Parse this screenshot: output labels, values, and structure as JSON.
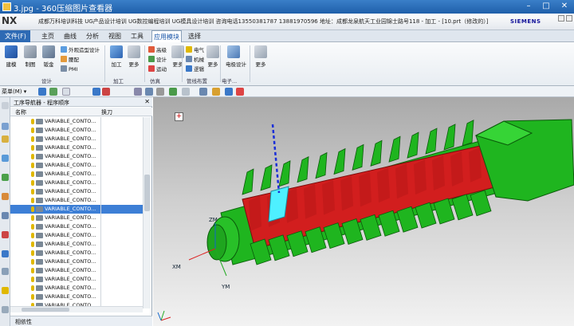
{
  "viewer": {
    "title": "3.jpg - 360压缩图片查看器",
    "min_label": "–",
    "max_label": "□",
    "close_label": "✕"
  },
  "nx": {
    "logo": "NX",
    "title_text": "成都万科培训科技    UG产品设计培训    UG数控编程培训    UG模具设计培训    咨询电话13550381787  13881970596   地址：成都龙泉航天工业园锦士路号118 - 加工 - [10.prt（修改的）]",
    "brand": "SIEMENS"
  },
  "menu": {
    "file": "文件(F)",
    "tabs": [
      "主页",
      "曲线",
      "分析",
      "视图",
      "工具",
      "应用模块",
      "选择"
    ],
    "active": "应用模块"
  },
  "ribbon": {
    "big": [
      "建模",
      "制图",
      "钣金"
    ],
    "small_col1": [
      "外观造型设计",
      "腰配",
      "PMI"
    ],
    "machining": "加工",
    "more": "更多",
    "sim": [
      "高级",
      "设计",
      "运动"
    ],
    "pipe": [
      "电气",
      "机械",
      "逻辑"
    ],
    "electrode": "电极设计",
    "groups": [
      "设计",
      "加工",
      "仿真",
      "管线布置",
      "电子..."
    ]
  },
  "toolbar2": {
    "menu_label": "菜单(M) ▾"
  },
  "navigator": {
    "title": "工序导航器 - 程序顺序",
    "col_name": "名称",
    "col_tool": "换刀",
    "rows": [
      "VARIABLE_CONTO...",
      "VARIABLE_CONTO...",
      "VARIABLE_CONTO...",
      "VARIABLE_CONTO...",
      "VARIABLE_CONTO...",
      "VARIABLE_CONTO...",
      "VARIABLE_CONTO...",
      "VARIABLE_CONTO...",
      "VARIABLE_CONTO...",
      "VARIABLE_CONTO...",
      "VARIABLE_CONTO...",
      "VARIABLE_CONTO...",
      "VARIABLE_CONTO...",
      "VARIABLE_CONTO...",
      "VARIABLE_CONTO...",
      "VARIABLE_CONTO...",
      "VARIABLE_CONTO...",
      "VARIABLE_CONTO...",
      "VARIABLE_CONTO...",
      "VARIABLE_CONTO...",
      "VARIABLE_CONTO...",
      "VARIABLE_CONTO..."
    ],
    "selected_index": 10,
    "dependency": "相依性"
  },
  "viewport": {
    "axis_zm": "ZM",
    "axis_xm": "XM",
    "axis_ym": "YM",
    "add_label": "+",
    "colors": {
      "green": "#1fb51f",
      "red": "#d21e1e",
      "cyan": "#4ef0ff",
      "blue": "#1a2ed8"
    }
  }
}
